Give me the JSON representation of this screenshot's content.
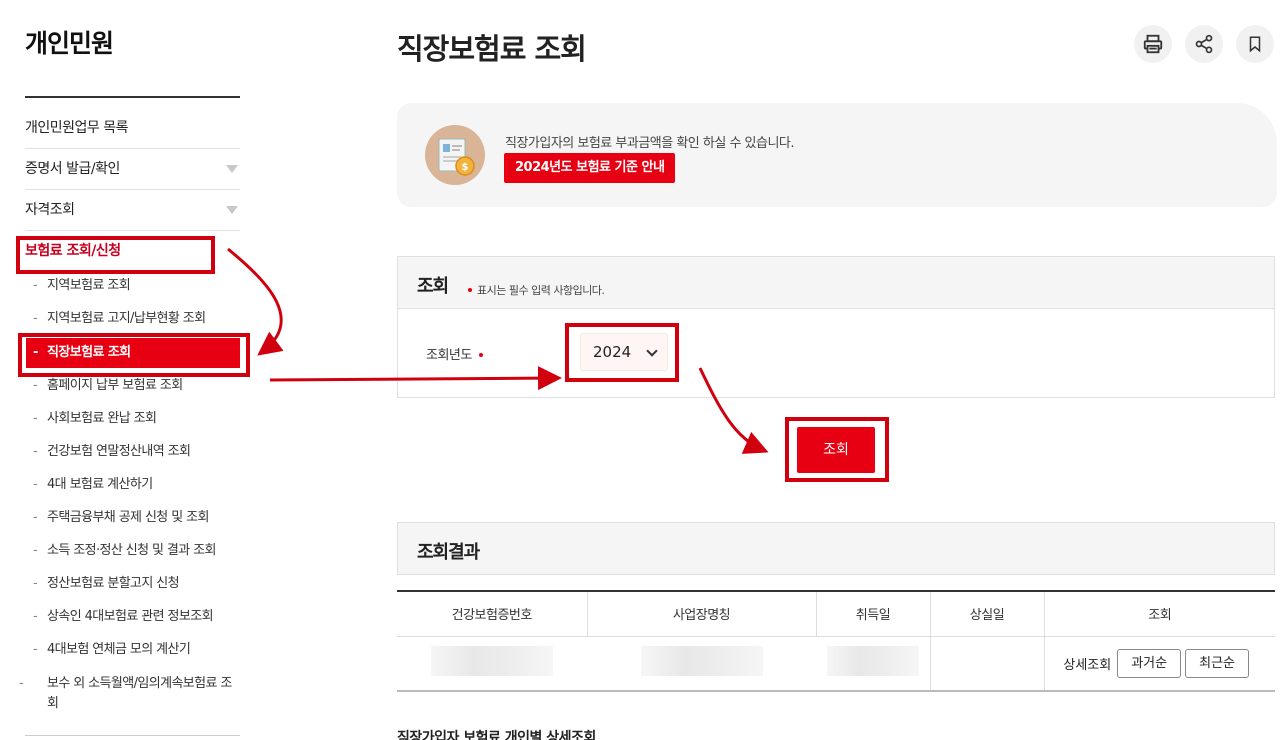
{
  "sidebar": {
    "title": "개인민원",
    "menu": [
      {
        "label": "개인민원업무 목록",
        "expandable": false
      },
      {
        "label": "증명서 발급/확인",
        "expandable": true
      },
      {
        "label": "자격조회",
        "expandable": true
      },
      {
        "label": "보험료 조회/신청",
        "expandable": false,
        "active": true
      }
    ],
    "sub_items": [
      {
        "label": "지역보험료 조회"
      },
      {
        "label": "지역보험료 고지/납부현황 조회"
      },
      {
        "label": "직장보험료 조회",
        "active": true
      },
      {
        "label": "홈페이지 납부 보험료 조회"
      },
      {
        "label": "사회보험료 완납 조회"
      },
      {
        "label": "건강보험 연말정산내역 조회"
      },
      {
        "label": "4대 보험료 계산하기"
      },
      {
        "label": "주택금융부채 공제 신청 및 조회"
      },
      {
        "label": "소득 조정·정산 신청 및 결과 조회"
      },
      {
        "label": "정산보험료 분할고지 신청"
      },
      {
        "label": "상속인 4대보험료 관련 정보조회"
      },
      {
        "label": "4대보험 연체금 모의 계산기"
      },
      {
        "label": "보수 외 소득월액/임의계속보험료 조회"
      }
    ],
    "dash": "-"
  },
  "header": {
    "title": "직장보험료 조회",
    "icons": [
      "print-icon",
      "share-icon",
      "bookmark-icon"
    ]
  },
  "info": {
    "text": "직장가입자의 보험료 부과금액을 확인 하실 수 있습니다.",
    "badge": "2024년도 보험료 기준 안내"
  },
  "search": {
    "title": "조회",
    "required_note": "표시는 필수 입력 사항입니다.",
    "field_label": "조회년도",
    "year_value": "2024",
    "button": "조회"
  },
  "result": {
    "title": "조회결과",
    "columns": [
      "건강보험증번호",
      "사업장명칭",
      "취득일",
      "상실일",
      "조회"
    ],
    "detail_label": "상세조회",
    "sort_past": "과거순",
    "sort_recent": "최근순"
  },
  "bottom_title": "직장가입자 보험료 개인별 상세조회",
  "colors": {
    "accent": "#e60012",
    "annotation": "#d0000f"
  }
}
